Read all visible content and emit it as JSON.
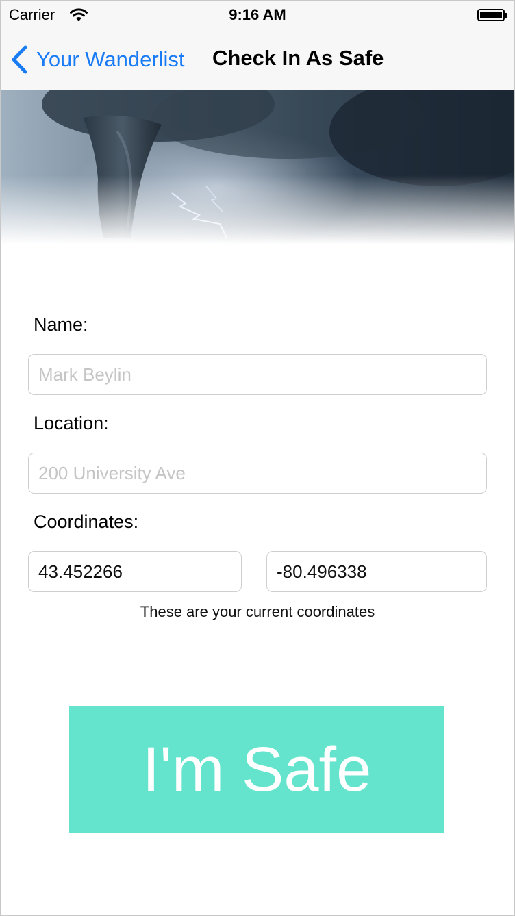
{
  "status_bar": {
    "carrier": "Carrier",
    "time": "9:16 AM"
  },
  "nav": {
    "back_label": "Your Wanderlist",
    "title": "Check In As Safe"
  },
  "form": {
    "name_label": "Name:",
    "name_placeholder": "Mark Beylin",
    "name_value": "",
    "location_label": "Location:",
    "location_placeholder": "200 University Ave",
    "location_value": "",
    "coordinates_label": "Coordinates:",
    "latitude_value": "43.452266",
    "longitude_value": "-80.496338",
    "coordinates_hint": "These are your current coordinates"
  },
  "actions": {
    "safe_label": "I'm Safe"
  },
  "colors": {
    "accent_blue": "#1a7cf5",
    "safe_button": "#64e4cc"
  },
  "icons": {
    "back": "chevron-left-icon",
    "wifi": "wifi-icon",
    "battery": "battery-icon"
  }
}
